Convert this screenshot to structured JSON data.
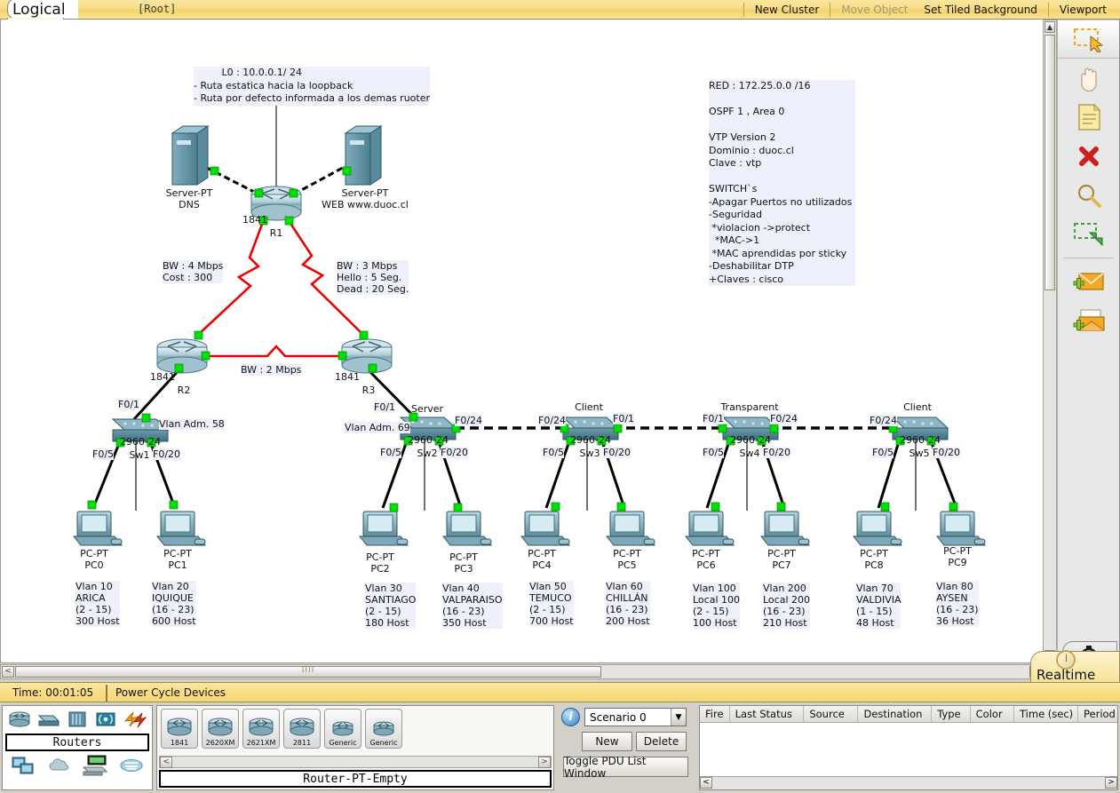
{
  "window": {
    "mode_tab": "Logical",
    "root_label": "[Root]",
    "toolbar_right": [
      {
        "label": "New Cluster",
        "enabled": true
      },
      {
        "label": "Move Object",
        "enabled": false
      },
      {
        "label": "Set Tiled Background",
        "enabled": true
      },
      {
        "label": "Viewport",
        "enabled": true
      }
    ]
  },
  "right_toolbar": [
    {
      "name": "select-tool",
      "icon": "select-arrow-icon",
      "selected": true
    },
    {
      "name": "move-layout-tool",
      "icon": "hand-icon",
      "selected": false
    },
    {
      "name": "place-note-tool",
      "icon": "note-icon",
      "selected": false
    },
    {
      "name": "delete-tool",
      "icon": "red-x-icon",
      "selected": false
    },
    {
      "name": "inspect-tool",
      "icon": "magnifier-icon",
      "selected": false
    },
    {
      "name": "resize-shape-tool",
      "icon": "resize-arrow-icon",
      "selected": false
    },
    {
      "name": "add-simple-pdu-tool",
      "icon": "envelope-plus-icon",
      "selected": false
    },
    {
      "name": "add-complex-pdu-tool",
      "icon": "open-envelope-plus-icon",
      "selected": false
    }
  ],
  "status_bar": {
    "time": "Time: 00:01:05",
    "power_cycle": "Power Cycle Devices",
    "mode": "Realtime"
  },
  "device_palette": {
    "category_label": "Routers",
    "type_icons_row1": [
      "router-icon",
      "switch-icon",
      "hub-icon",
      "wireless-icon",
      "connections-icon"
    ],
    "type_icons_row2": [
      "end-devices-icon",
      "wan-cloud-icon",
      "custom-device-icon",
      "multiuser-cloud-icon"
    ],
    "models": [
      {
        "label": "1841"
      },
      {
        "label": "2620XM"
      },
      {
        "label": "2621XM"
      },
      {
        "label": "2811"
      },
      {
        "label": "Generic"
      },
      {
        "label": "Generic"
      }
    ],
    "status": "Router-PT-Empty"
  },
  "scenario_panel": {
    "selected_scenario": "Scenario 0",
    "new_label": "New",
    "delete_label": "Delete",
    "toggle_label": "Toggle PDU List Window"
  },
  "pdu_table": {
    "columns": [
      "Fire",
      "Last Status",
      "Source",
      "Destination",
      "Type",
      "Color",
      "Time (sec)",
      "Period"
    ],
    "rows": []
  },
  "notes": {
    "loopback": "         L0 : 10.0.0.1/ 24\n- Ruta estatica hacia la loopback\n- Ruta por defecto informada a los demas ruoter",
    "config": "RED : 172.25.0.0 /16\n\nOSPF 1 , Area 0\n\nVTP Version 2\nDominio : duoc.cl\nClave : vtp\n\nSWITCH`s\n-Apagar Puertos no utilizados\n-Seguridad\n *violacion ->protect\n  *MAC->1\n *MAC aprendidas por sticky\n-Deshabilitar DTP\n+Claves : cisco"
  },
  "link_labels": {
    "r1_r2": "BW : 4 Mbps\nCost : 300",
    "r1_r3": "BW : 3 Mbps\nHello : 5 Seg.\nDead : 20 Seg.",
    "r2_r3": "BW : 2 Mbps"
  },
  "servers": [
    {
      "model": "Server-PT",
      "name": "DNS"
    },
    {
      "model": "Server-PT",
      "name": "WEB www.duoc.cl"
    }
  ],
  "routers": [
    {
      "model": "1841",
      "name": "R1"
    },
    {
      "model": "1841",
      "name": "R2"
    },
    {
      "model": "1841",
      "name": "R3"
    }
  ],
  "switches": [
    {
      "model": "2960-24",
      "name": "Sw1",
      "vtp_role": "",
      "vlan_adm": "Vlan Adm. 58",
      "ports": {
        "uplink": "F0/1",
        "left": "F0/5",
        "right": "F0/20",
        "trunk": ""
      }
    },
    {
      "model": "2960-24",
      "name": "Sw2",
      "vtp_role": "Server",
      "vlan_adm": "Vlan Adm. 69",
      "ports": {
        "uplink": "F0/1",
        "left": "F0/5",
        "right": "F0/20",
        "trunk": "F0/24"
      }
    },
    {
      "model": "2960-24",
      "name": "Sw3",
      "vtp_role": "Client",
      "vlan_adm": "",
      "ports": {
        "uplink": "F0/1",
        "left": "F0/5",
        "right": "F0/20",
        "trunk": "F0/24"
      }
    },
    {
      "model": "2960-24",
      "name": "Sw4",
      "vtp_role": "Transparent",
      "vlan_adm": "",
      "ports": {
        "uplink": "F0/1",
        "left": "F0/5",
        "right": "F0/20",
        "trunk": "F0/24"
      }
    },
    {
      "model": "2960-24",
      "name": "Sw5",
      "vtp_role": "Client",
      "vlan_adm": "",
      "ports": {
        "uplink": "",
        "left": "F0/5",
        "right": "F0/20",
        "trunk": "F0/24"
      }
    }
  ],
  "pcs": [
    {
      "model": "PC-PT",
      "name": "PC0",
      "info": "Vlan 10\nARICA\n(2 - 15)\n300 Host"
    },
    {
      "model": "PC-PT",
      "name": "PC1",
      "info": "Vlan 20\nIQUIQUE\n(16 - 23)\n600 Host"
    },
    {
      "model": "PC-PT",
      "name": "PC2",
      "info": "Vlan 30\nSANTIAGO\n(2 - 15)\n180 Host"
    },
    {
      "model": "PC-PT",
      "name": "PC3",
      "info": "Vlan 40\nVALPARAISO\n(16 - 23)\n350 Host"
    },
    {
      "model": "PC-PT",
      "name": "PC4",
      "info": "Vlan 50\nTEMUCO\n(2 - 15)\n700 Host"
    },
    {
      "model": "PC-PT",
      "name": "PC5",
      "info": "Vlan 60\nCHILLÁN\n(16 - 23)\n200 Host"
    },
    {
      "model": "PC-PT",
      "name": "PC6",
      "info": "Vlan 100\nLocal 100\n(2 - 15)\n100 Host"
    },
    {
      "model": "PC-PT",
      "name": "PC7",
      "info": "Vlan 200\nLocal 200\n(16 - 23)\n210 Host"
    },
    {
      "model": "PC-PT",
      "name": "PC8",
      "info": "Vlan 70\nVALDIVIA\n(1 - 15)\n48 Host"
    },
    {
      "model": "PC-PT",
      "name": "PC9",
      "info": "Vlan 80\nAYSEN\n(16 - 23)\n36 Host"
    }
  ],
  "colors": {
    "serial_link": "#ee0000",
    "ethernet_link": "#000000",
    "led_up": "#00e000",
    "note_bg": "#eef1fb",
    "titlebar": "#f7dd85"
  }
}
